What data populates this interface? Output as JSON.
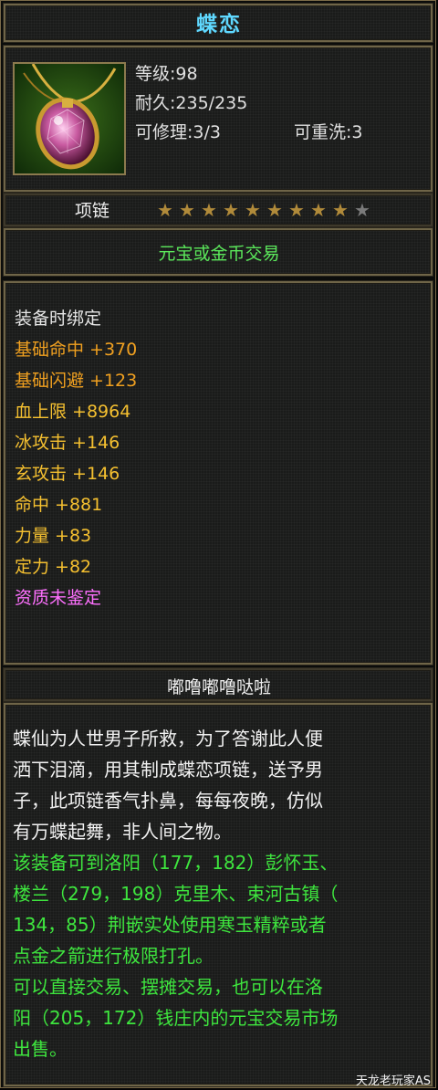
{
  "item": {
    "name": "蝶恋",
    "level": "等级:98",
    "durability": "耐久:235/235",
    "repairable": "可修理:3/3",
    "rewashable": "可重洗:3",
    "type": "项链",
    "stars_filled": 9,
    "stars_total": 10,
    "trade": "元宝或金币交易"
  },
  "attributes": {
    "bind": "装备时绑定",
    "hit_base": "基础命中 +370",
    "dodge_base": "基础闪避 +123",
    "hp": "血上限 +8964",
    "ice_atk": "冰攻击 +146",
    "mystic_atk": "玄攻击 +146",
    "hit": "命中 +881",
    "strength": "力量 +83",
    "focus": "定力 +82",
    "quality": "资质未鉴定"
  },
  "description": {
    "title": "嘟噜嘟噜哒啦",
    "lines": [
      "蝶仙为人世男子所救，为了答谢此人便",
      "洒下泪滴，用其制成蝶恋项链，送予男",
      "子，此项链香气扑鼻，每每夜晚，仿似",
      "有万蝶起舞，非人间之物。",
      "该装备可到洛阳（177，182）彭怀玉、",
      "楼兰（279，198）克里木、束河古镇（",
      "134，85）荆嵌实处使用寒玉精粹或者",
      "点金之箭进行极限打孔。",
      "可以直接交易、摆摊交易，也可以在洛",
      "阳（205，172）钱庄内的元宝交易市场",
      "出售。"
    ]
  },
  "watermark": "天龙老玩家AS",
  "colors": {
    "title": "#5fd8ff",
    "trade": "#5be85b",
    "attr_white": "#e6e6e6",
    "attr_orange": "#f0a020",
    "attr_yellow": "#f5c030",
    "attr_pink": "#ff70ff",
    "desc_green": "#3ee53e",
    "star_filled": "#b08a3a",
    "star_empty": "#7a7a7a"
  },
  "icons": {
    "item": "pink-gem-pendant-icon",
    "star": "star-icon"
  }
}
